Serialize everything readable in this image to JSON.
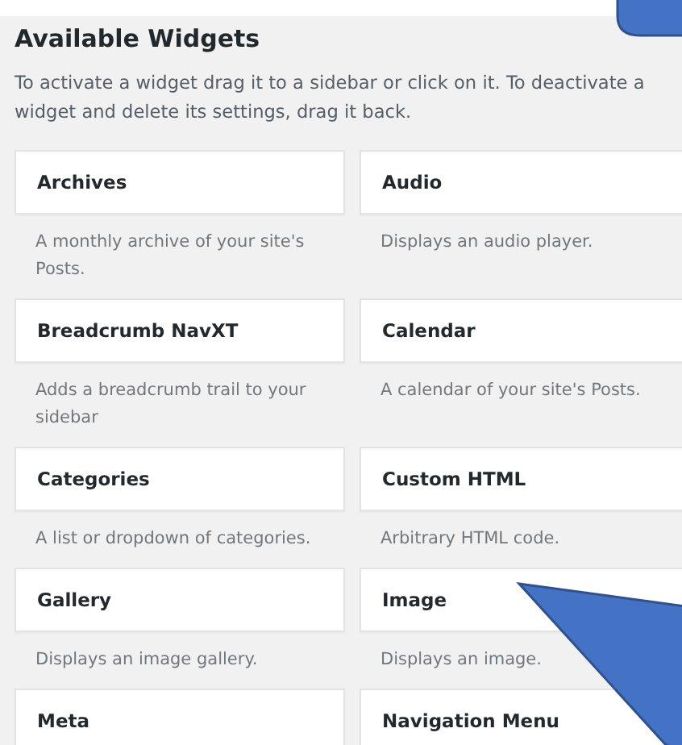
{
  "panel": {
    "title": "Available Widgets",
    "description": "To activate a widget drag it to a sidebar or click on it. To deactivate a widget and delete its settings, drag it back."
  },
  "widgets": [
    {
      "name": "Archives",
      "description": "A monthly archive of your site's Posts."
    },
    {
      "name": "Audio",
      "description": "Displays an audio player."
    },
    {
      "name": "Breadcrumb NavXT",
      "description": "Adds a breadcrumb trail to your sidebar"
    },
    {
      "name": "Calendar",
      "description": "A calendar of your site's Posts."
    },
    {
      "name": "Categories",
      "description": "A list or dropdown of categories."
    },
    {
      "name": "Custom HTML",
      "description": "Arbitrary HTML code."
    },
    {
      "name": "Gallery",
      "description": "Displays an image gallery."
    },
    {
      "name": "Image",
      "description": "Displays an image."
    },
    {
      "name": "Meta"
    },
    {
      "name": "Navigation Menu"
    }
  ]
}
